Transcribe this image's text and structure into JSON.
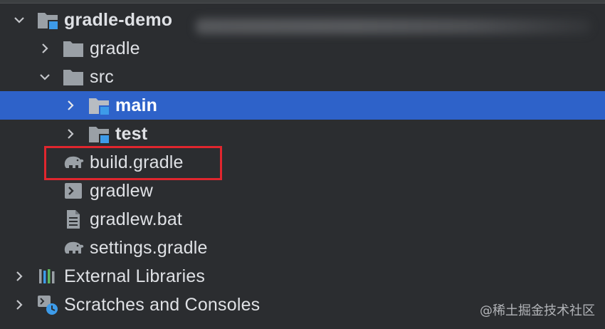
{
  "tree": {
    "root": {
      "label": "gradle-demo",
      "expanded": true
    },
    "items": [
      {
        "label": "gradle",
        "type": "folder",
        "expanded": false
      },
      {
        "label": "src",
        "type": "folder",
        "expanded": true
      },
      {
        "label": "main",
        "type": "source-folder",
        "expanded": false,
        "selected": true
      },
      {
        "label": "test",
        "type": "test-folder",
        "expanded": false
      },
      {
        "label": "build.gradle",
        "type": "gradle-file",
        "highlighted": true
      },
      {
        "label": "gradlew",
        "type": "shell-script"
      },
      {
        "label": "gradlew.bat",
        "type": "text-file"
      },
      {
        "label": "settings.gradle",
        "type": "gradle-file"
      }
    ],
    "external_libraries": {
      "label": "External Libraries"
    },
    "scratches": {
      "label": "Scratches and Consoles"
    }
  },
  "watermark": "@稀土掘金技术社区",
  "colors": {
    "background": "#2b2d30",
    "selection": "#2e62c9",
    "highlight_border": "#e0262e",
    "folder_icon": "#9aa0a6",
    "module_badge": "#3d9be9"
  }
}
